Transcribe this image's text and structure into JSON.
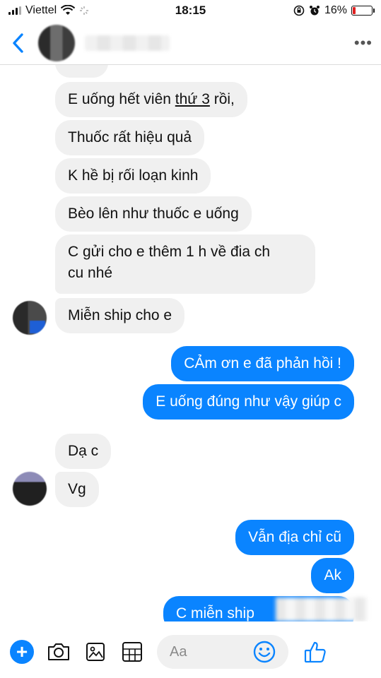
{
  "status_bar": {
    "carrier": "Viettel",
    "time": "18:15",
    "battery": "16%"
  },
  "messages": [
    {
      "side": "in",
      "text": "E uống hết viên thứ 3 rồi,"
    },
    {
      "side": "in",
      "text": "Thuốc rất hiệu quả"
    },
    {
      "side": "in",
      "text": "K hề bị rối loạn kinh"
    },
    {
      "side": "in",
      "text": "Bèo lên như thuốc e uống"
    },
    {
      "side": "in",
      "text_line1": "C gửi cho  e thêm 1 h về đia ch",
      "text_line2": "cu nhé"
    },
    {
      "side": "in",
      "text": "Miễn ship cho e"
    },
    {
      "side": "out",
      "text": "CẢm ơn e đã phản hồi !"
    },
    {
      "side": "out",
      "text": "E uống đúng như vậy giúp c"
    },
    {
      "side": "in",
      "text": "Dạ c"
    },
    {
      "side": "in",
      "text": "Vg"
    },
    {
      "side": "out",
      "text": "Vẫn địa chỉ cũ"
    },
    {
      "side": "out",
      "text": "Ak"
    },
    {
      "side": "out",
      "text": "C miễn ship"
    }
  ],
  "composer": {
    "placeholder": "Aa"
  },
  "colors": {
    "accent": "#0a84ff",
    "incoming_bubble": "#f0f0f0",
    "battery_low": "#e02020"
  },
  "icons": [
    "back-chevron-icon",
    "more-dots-icon",
    "plus-icon",
    "camera-icon",
    "image-icon",
    "sticker-grid-icon",
    "emoji-icon",
    "thumbs-up-icon"
  ]
}
